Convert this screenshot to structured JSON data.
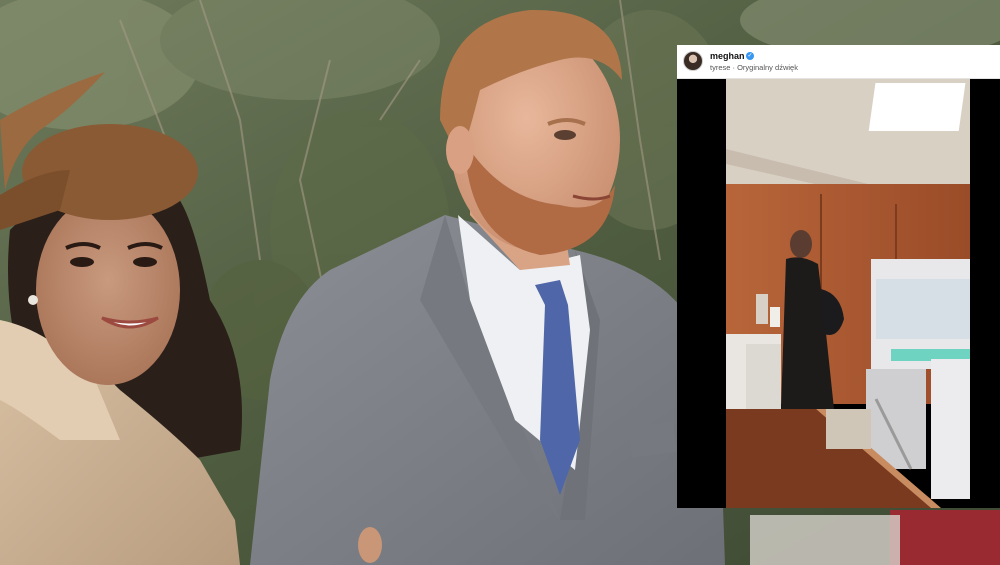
{
  "post": {
    "username": "meghan",
    "audio_line": "tyrese · Oryginalny dźwięk"
  },
  "icons": {
    "verified": "verified-badge-icon",
    "avatar": "profile-avatar"
  },
  "colors": {
    "coat_gray": "#7d8187",
    "tie_blue": "#4f66a8",
    "hat_brown": "#8a5a34",
    "cabinet_wood": "#a8562e",
    "verified_blue": "#3897f0"
  }
}
